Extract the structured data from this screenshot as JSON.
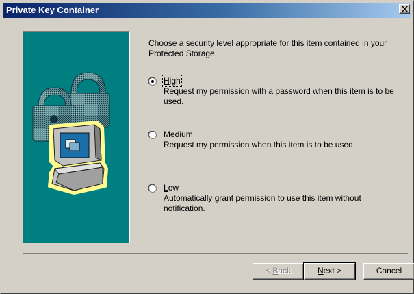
{
  "window": {
    "title": "Private Key Container"
  },
  "intro_text": "Choose a security level appropriate for this item contained in your Protected Storage.",
  "options": [
    {
      "key": "H",
      "label_rest": "igh",
      "description": "Request my permission with a password when this item is to be used.",
      "selected": true
    },
    {
      "key": "M",
      "label_rest": "edium",
      "description": "Request my permission when this item is to be used.",
      "selected": false
    },
    {
      "key": "L",
      "label_rest": "ow",
      "description": "Automatically grant permission to use this item without notification.",
      "selected": false
    }
  ],
  "buttons": {
    "back_prefix": "< ",
    "back_key": "B",
    "back_rest": "ack",
    "next_key": "N",
    "next_rest": "ext >",
    "cancel": "Cancel"
  },
  "colors": {
    "title_gradient_start": "#0a246a",
    "title_gradient_end": "#a6caf0",
    "dialog_face": "#d4d0c8",
    "art_background": "#007f80"
  },
  "icons": {
    "close": "close-icon",
    "art": "computer-with-padlocks-illustration"
  }
}
